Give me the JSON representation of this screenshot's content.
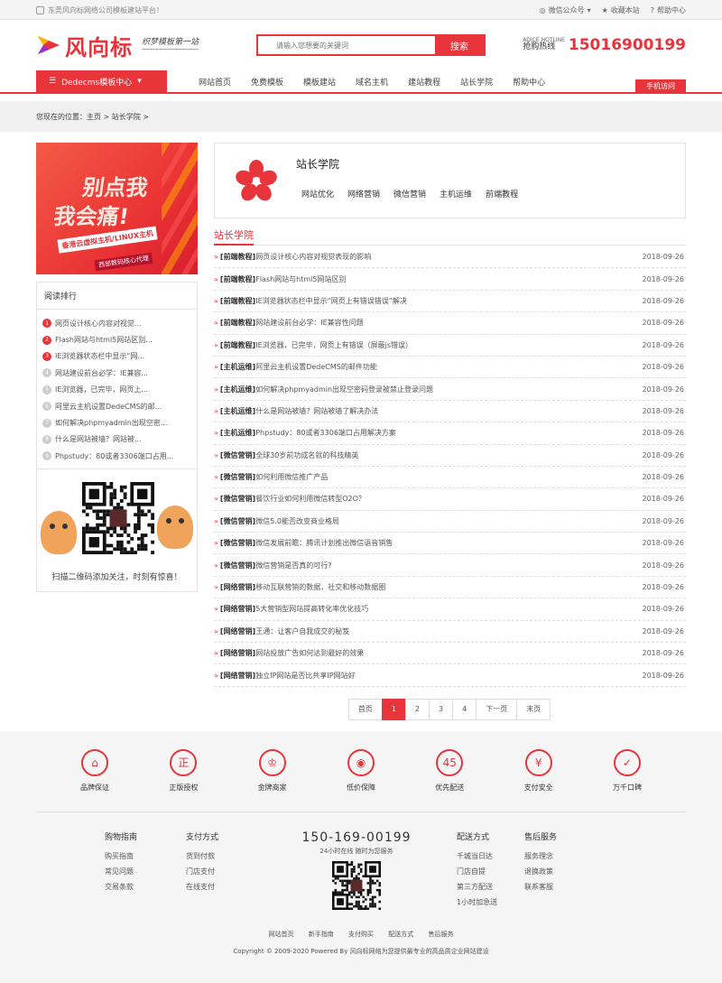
{
  "topbar": {
    "left": "东莞风向标网络公司模板建站平台！",
    "wechat": "微信公众号",
    "favorite": "收藏本站",
    "help": "帮助中心"
  },
  "header": {
    "logo": "风向标",
    "slogan": "织梦模板第一站",
    "search_placeholder": "请输入您想要的关键词",
    "search_button": "搜索",
    "hotline_en": "ADICE HOTLINE",
    "hotline_label": "抢购热线",
    "hotline_number": "15016900199"
  },
  "nav": {
    "category": "Dedecms模板中心",
    "items": [
      "网站首页",
      "免费模板",
      "模板建站",
      "域名主机",
      "建站教程",
      "站长学院",
      "帮助中心"
    ],
    "mobile": "手机访问"
  },
  "breadcrumb": {
    "prefix": "您现在的位置：",
    "home": "主页",
    "sep1": ">",
    "current": "站长学院",
    "sep2": ">"
  },
  "banner": {
    "line1": "别点我",
    "line2": "我会痛!",
    "line3": "香港云虚拟主机/LINUX主机",
    "line4": "西部数码核心代理"
  },
  "rank": {
    "title": "阅读排行",
    "items": [
      "网页设计核心内容对视觉...",
      "Flash网站与html5网站区别...",
      "IE浏览器状态栏中显示“网...",
      "网站建设前台必学：IE兼容...",
      "IE浏览器，已完毕，网页上...",
      "阿里云主机设置DedeCMS的邮...",
      "如何解决phpmyadmin出现空密...",
      "什么是网站被墙？网站被...",
      "Phpstudy：80或者3306端口占用..."
    ]
  },
  "qr": {
    "caption": "扫描二维码添加关注，时刻有惊喜！"
  },
  "category": {
    "title": "站长学院",
    "subs": [
      "网站优化",
      "网络营销",
      "微信营销",
      "主机运维",
      "前端教程"
    ]
  },
  "list": {
    "title": "站长学院",
    "items": [
      {
        "tag": "[前端教程]",
        "title": "网页设计核心内容对视觉表现的影响",
        "date": "2018-09-26"
      },
      {
        "tag": "[前端教程]",
        "title": "Flash网站与html5网站区别",
        "date": "2018-09-26"
      },
      {
        "tag": "[前端教程]",
        "title": "IE浏览器状态栏中显示“网页上有错误错误”解决",
        "date": "2018-09-26"
      },
      {
        "tag": "[前端教程]",
        "title": "网站建设前台必学：IE兼容性问题",
        "date": "2018-09-26"
      },
      {
        "tag": "[前端教程]",
        "title": "IE浏览器，已完毕，网页上有错误（屏蔽js错误）",
        "date": "2018-09-26"
      },
      {
        "tag": "[主机运维]",
        "title": "阿里云主机设置DedeCMS的邮件功能",
        "date": "2018-09-26"
      },
      {
        "tag": "[主机运维]",
        "title": "如何解决phpmyadmin出现空密码登录被禁止登录问题",
        "date": "2018-09-26"
      },
      {
        "tag": "[主机运维]",
        "title": "什么是网站被墙？网站被墙了解决办法",
        "date": "2018-09-26"
      },
      {
        "tag": "[主机运维]",
        "title": "Phpstudy：80或者3306端口占用解决方案",
        "date": "2018-09-26"
      },
      {
        "tag": "[微信营销]",
        "title": "全球30岁前功成名就的科技精英",
        "date": "2018-09-26"
      },
      {
        "tag": "[微信营销]",
        "title": "如何利用微信推广产品",
        "date": "2018-09-26"
      },
      {
        "tag": "[微信营销]",
        "title": "餐饮行业如何利用微信转型O2O？",
        "date": "2018-09-26"
      },
      {
        "tag": "[微信营销]",
        "title": "微信5.0能否改变商业格局",
        "date": "2018-09-26"
      },
      {
        "tag": "[微信营销]",
        "title": "微信发展前瞻：腾讯计划推出微信语音销售",
        "date": "2018-09-26"
      },
      {
        "tag": "[微信营销]",
        "title": "微信营销是否真的可行?",
        "date": "2018-09-26"
      },
      {
        "tag": "[网络营销]",
        "title": "移动互联营销的数据，社交和移动数据圈",
        "date": "2018-09-26"
      },
      {
        "tag": "[网络营销]",
        "title": "5大营销型网站提高转化率优化技巧",
        "date": "2018-09-26"
      },
      {
        "tag": "[网络营销]",
        "title": "王通：让客户自我成交的秘笈",
        "date": "2018-09-26"
      },
      {
        "tag": "[网络营销]",
        "title": "网站投放广告如何达到最好的效果",
        "date": "2018-09-26"
      },
      {
        "tag": "[网络营销]",
        "title": "独立IP网站是否比共享IP网站好",
        "date": "2018-09-26"
      }
    ]
  },
  "pager": {
    "first": "首页",
    "pages": [
      "1",
      "2",
      "3",
      "4"
    ],
    "next": "下一页",
    "last": "末页",
    "current": "1"
  },
  "features": [
    {
      "icon": "shop-icon",
      "glyph": "⌂",
      "label": "品牌保证"
    },
    {
      "icon": "license-icon",
      "glyph": "正",
      "label": "正版授权"
    },
    {
      "icon": "trophy-icon",
      "glyph": "♔",
      "label": "金牌商家"
    },
    {
      "icon": "price-icon",
      "glyph": "◉",
      "label": "低价保障"
    },
    {
      "icon": "delivery-icon",
      "glyph": "45",
      "label": "优先配送"
    },
    {
      "icon": "yen-icon",
      "glyph": "¥",
      "label": "支付安全"
    },
    {
      "icon": "thumb-icon",
      "glyph": "✓",
      "label": "万千口碑"
    }
  ],
  "footer": {
    "col1": {
      "title": "购物指南",
      "items": [
        "购买指南",
        "常见问题",
        "交易条款"
      ]
    },
    "col2": {
      "title": "支付方式",
      "items": [
        "货到付款",
        "门店支付",
        "在线支付"
      ]
    },
    "phone": "150-169-00199",
    "service": "24小时在线 随时为您服务",
    "col3": {
      "title": "配送方式",
      "items": [
        "千城当日达",
        "门店自提",
        "第三方配送",
        "1小时加急送"
      ]
    },
    "col4": {
      "title": "售后服务",
      "items": [
        "服务理念",
        "退换政策",
        "联系客服"
      ]
    },
    "links": [
      "网站首页",
      "新手指南",
      "支付购买",
      "配送方式",
      "售后服务"
    ],
    "copyright": "Copyright © 2009-2020 Powered By 风向标网络为您提供最专业的高品质企业网站建设"
  },
  "colors": {
    "accent": "#e8343b"
  }
}
